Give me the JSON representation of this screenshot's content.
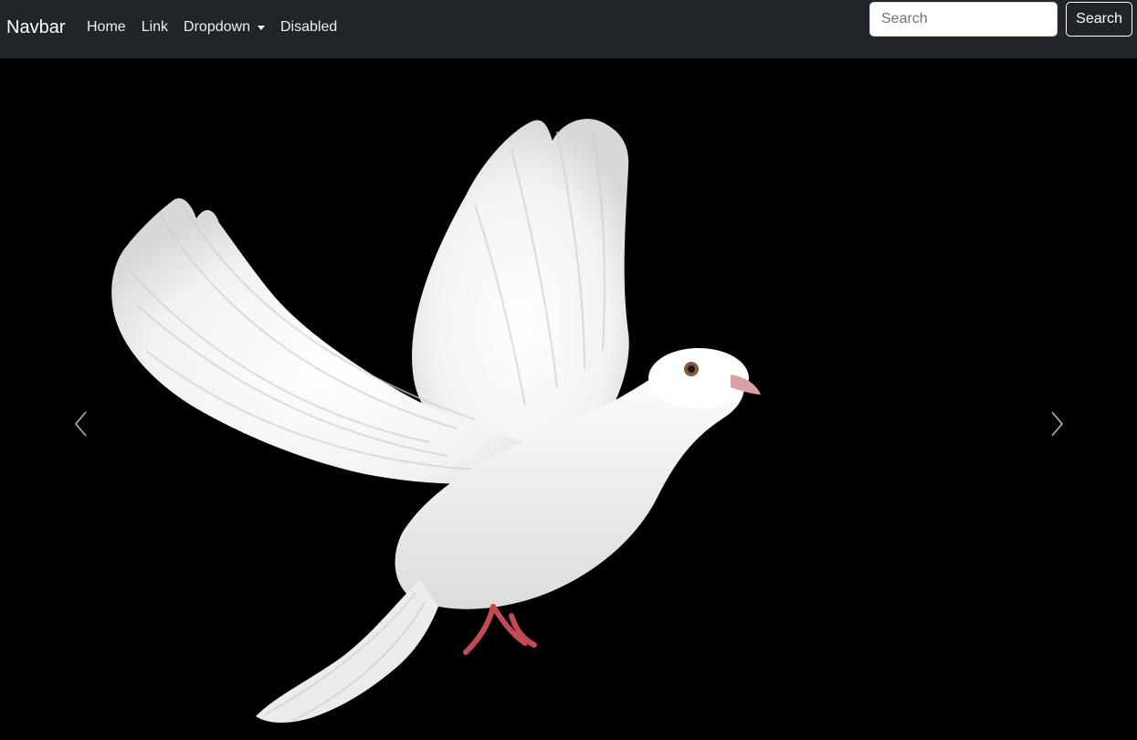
{
  "navbar": {
    "brand": "Navbar",
    "links": [
      {
        "label": "Home"
      },
      {
        "label": "Link"
      },
      {
        "label": "Dropdown"
      },
      {
        "label": "Disabled"
      }
    ],
    "search": {
      "placeholder": "Search",
      "value": "",
      "button_label": "Search"
    },
    "background_color": "#212529"
  },
  "carousel": {
    "slide_image": "white-dove-icon",
    "controls": {
      "prev_icon": "chevron-left-icon",
      "next_icon": "chevron-right-icon"
    },
    "background_color": "#000000"
  }
}
